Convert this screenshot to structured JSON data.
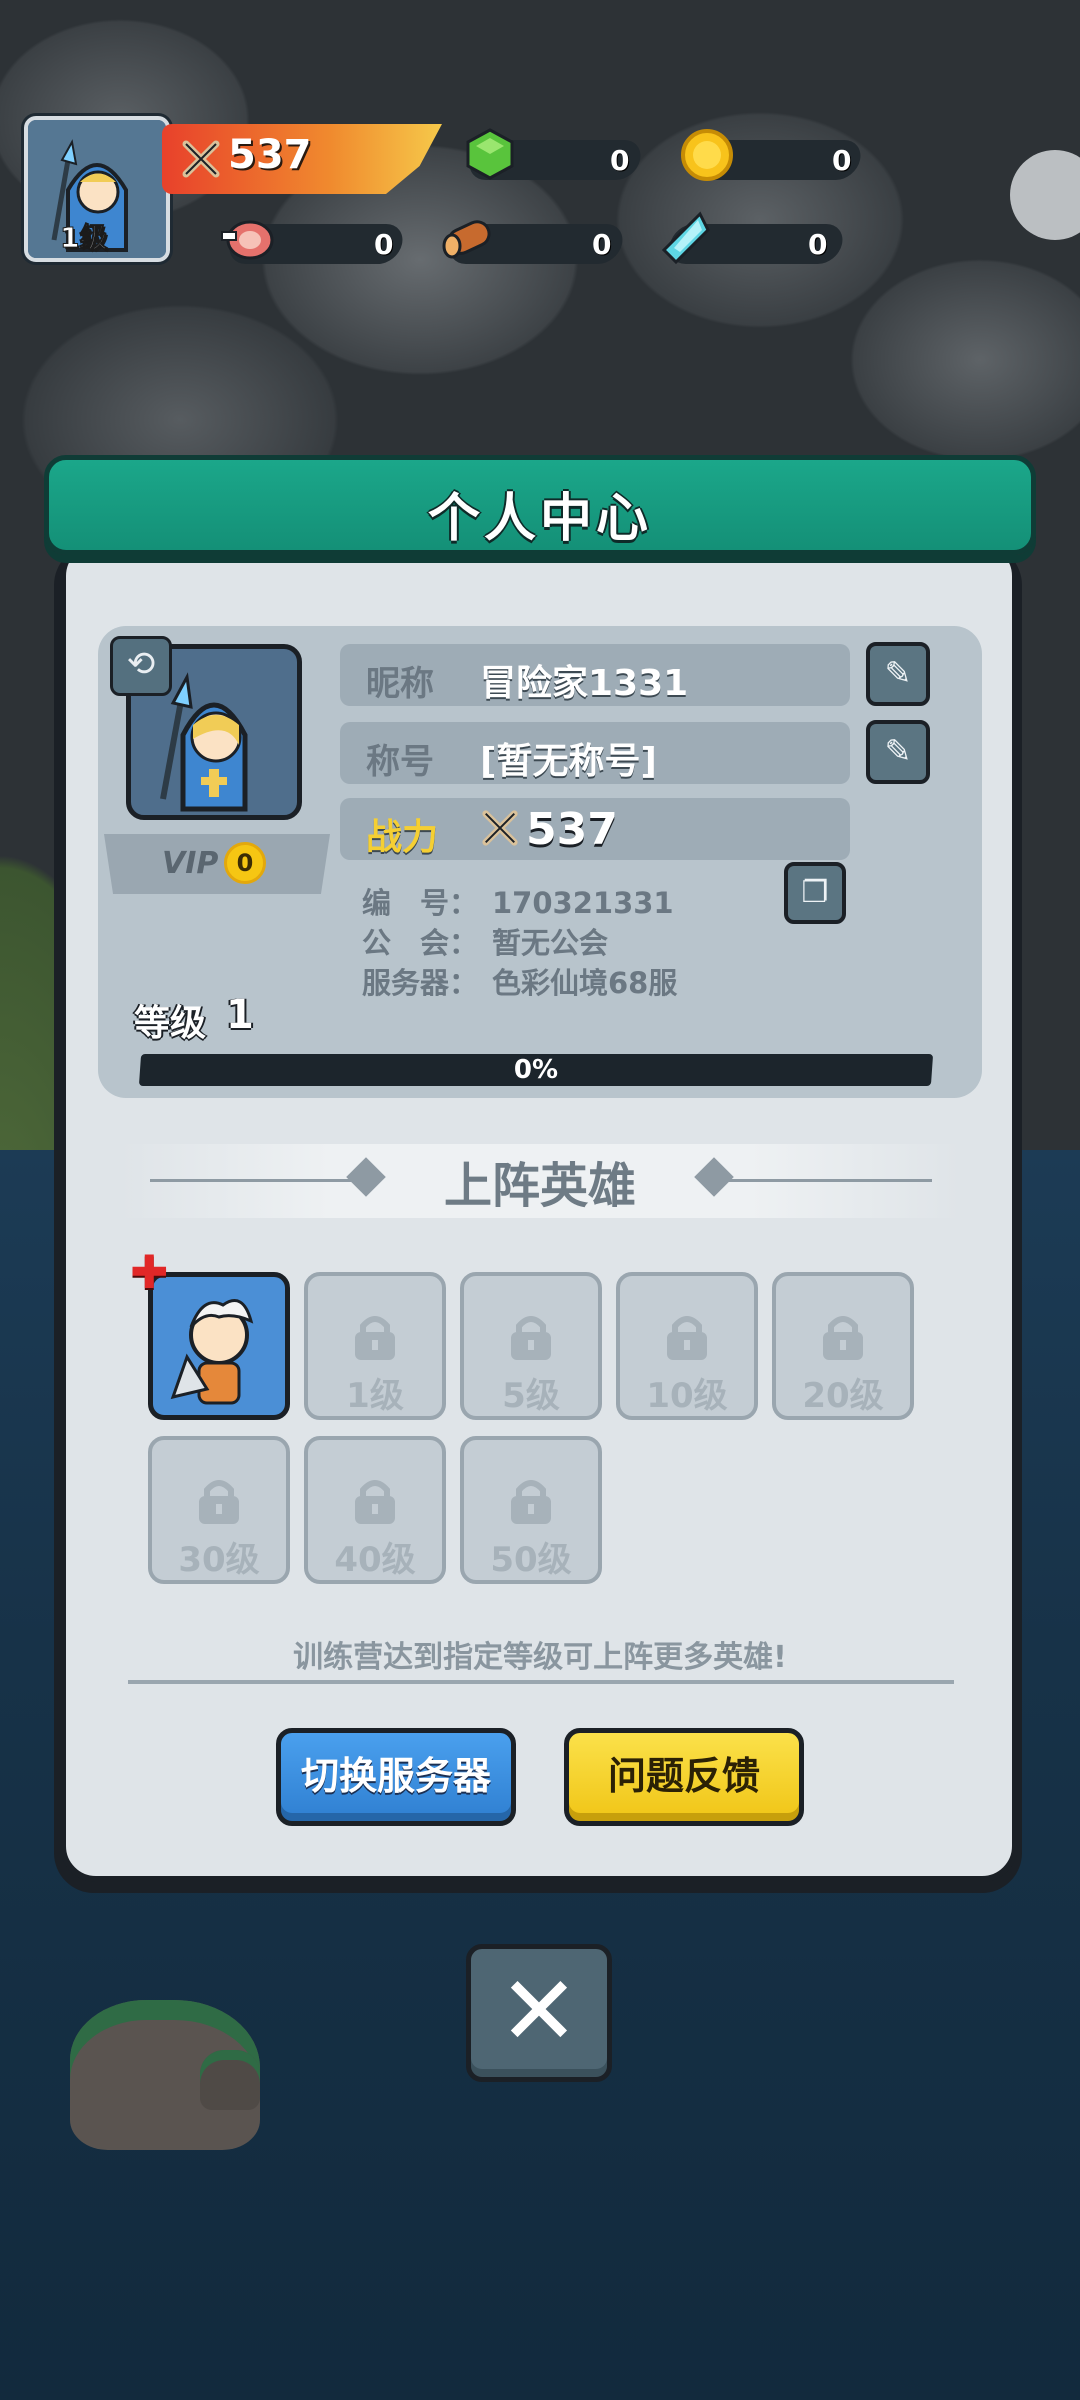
{
  "hud": {
    "level_badge": "1级",
    "power": "537",
    "resources": {
      "gem": "0",
      "gold": "0",
      "meat": "0",
      "wood": "0",
      "crystal": "0"
    }
  },
  "panel": {
    "title": "个人中心",
    "profile": {
      "vip_label": "VIP",
      "vip_level": "0",
      "nickname_label": "昵称",
      "nickname_value": "冒险家1331",
      "title_label": "称号",
      "title_value": "[暂无称号]",
      "power_label": "战力",
      "power_value": "537",
      "id_key": "编　号：",
      "id_value": "170321331",
      "guild_key": "公　会：",
      "guild_value": "暂无公会",
      "server_key": "服务器：",
      "server_value": "色彩仙境68服",
      "level_label": "等级",
      "level_value": "1",
      "xp_percent_text": "0%",
      "xp_progress": 0
    },
    "heroes": {
      "section_title": "上阵英雄",
      "slots": [
        {
          "label": "",
          "locked": false
        },
        {
          "label": "1级",
          "locked": true
        },
        {
          "label": "5级",
          "locked": true
        },
        {
          "label": "10级",
          "locked": true
        },
        {
          "label": "20级",
          "locked": true
        },
        {
          "label": "30级",
          "locked": true
        },
        {
          "label": "40级",
          "locked": true
        },
        {
          "label": "50级",
          "locked": true
        }
      ],
      "hint": "训练营达到指定等级可上阵更多英雄!"
    },
    "buttons": {
      "switch_server": "切换服务器",
      "feedback": "问题反馈"
    }
  },
  "colors": {
    "title_green": "#1ba78a",
    "gold": "#f5cf33",
    "blue_button": "#3b8fe0",
    "yellow_button": "#f5d42a"
  }
}
